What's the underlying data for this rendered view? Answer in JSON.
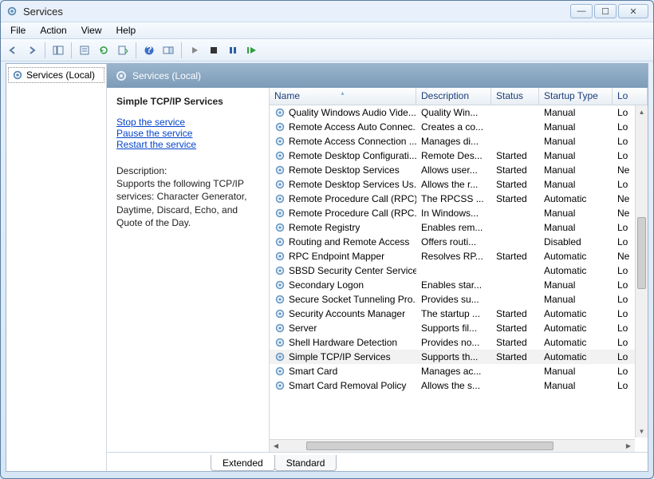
{
  "window": {
    "title": "Services"
  },
  "menu": {
    "file": "File",
    "action": "Action",
    "view": "View",
    "help": "Help"
  },
  "tree": {
    "root": "Services (Local)"
  },
  "pane": {
    "heading": "Services (Local)"
  },
  "descpanel": {
    "title": "Simple TCP/IP Services",
    "stop": "Stop",
    "stop_sfx": " the service",
    "pause": "Pause",
    "pause_sfx": " the service",
    "restart": "Restart",
    "restart_sfx": " the service",
    "desc_label": "Description:",
    "desc_body": "Supports the following TCP/IP services: Character Generator, Daytime, Discard, Echo, and Quote of the Day."
  },
  "columns": {
    "name": "Name",
    "desc": "Description",
    "status": "Status",
    "startup": "Startup Type",
    "logon": "Lo"
  },
  "tabs": {
    "extended": "Extended",
    "standard": "Standard"
  },
  "services": [
    {
      "name": "Quality Windows Audio Vide...",
      "desc": "Quality Win...",
      "status": "",
      "startup": "Manual",
      "log": "Lo"
    },
    {
      "name": "Remote Access Auto Connec...",
      "desc": "Creates a co...",
      "status": "",
      "startup": "Manual",
      "log": "Lo"
    },
    {
      "name": "Remote Access Connection ...",
      "desc": "Manages di...",
      "status": "",
      "startup": "Manual",
      "log": "Lo"
    },
    {
      "name": "Remote Desktop Configurati...",
      "desc": "Remote Des...",
      "status": "Started",
      "startup": "Manual",
      "log": "Lo"
    },
    {
      "name": "Remote Desktop Services",
      "desc": "Allows user...",
      "status": "Started",
      "startup": "Manual",
      "log": "Ne"
    },
    {
      "name": "Remote Desktop Services Us...",
      "desc": "Allows the r...",
      "status": "Started",
      "startup": "Manual",
      "log": "Lo"
    },
    {
      "name": "Remote Procedure Call (RPC)",
      "desc": "The RPCSS ...",
      "status": "Started",
      "startup": "Automatic",
      "log": "Ne"
    },
    {
      "name": "Remote Procedure Call (RPC...",
      "desc": "In Windows...",
      "status": "",
      "startup": "Manual",
      "log": "Ne"
    },
    {
      "name": "Remote Registry",
      "desc": "Enables rem...",
      "status": "",
      "startup": "Manual",
      "log": "Lo"
    },
    {
      "name": "Routing and Remote Access",
      "desc": "Offers routi...",
      "status": "",
      "startup": "Disabled",
      "log": "Lo"
    },
    {
      "name": "RPC Endpoint Mapper",
      "desc": "Resolves RP...",
      "status": "Started",
      "startup": "Automatic",
      "log": "Ne"
    },
    {
      "name": "SBSD Security Center Service",
      "desc": "",
      "status": "",
      "startup": "Automatic",
      "log": "Lo"
    },
    {
      "name": "Secondary Logon",
      "desc": "Enables star...",
      "status": "",
      "startup": "Manual",
      "log": "Lo"
    },
    {
      "name": "Secure Socket Tunneling Pro...",
      "desc": "Provides su...",
      "status": "",
      "startup": "Manual",
      "log": "Lo"
    },
    {
      "name": "Security Accounts Manager",
      "desc": "The startup ...",
      "status": "Started",
      "startup": "Automatic",
      "log": "Lo"
    },
    {
      "name": "Server",
      "desc": "Supports fil...",
      "status": "Started",
      "startup": "Automatic",
      "log": "Lo"
    },
    {
      "name": "Shell Hardware Detection",
      "desc": "Provides no...",
      "status": "Started",
      "startup": "Automatic",
      "log": "Lo"
    },
    {
      "name": "Simple TCP/IP Services",
      "desc": "Supports th...",
      "status": "Started",
      "startup": "Automatic",
      "log": "Lo",
      "selected": true
    },
    {
      "name": "Smart Card",
      "desc": "Manages ac...",
      "status": "",
      "startup": "Manual",
      "log": "Lo"
    },
    {
      "name": "Smart Card Removal Policy",
      "desc": "Allows the s...",
      "status": "",
      "startup": "Manual",
      "log": "Lo"
    }
  ]
}
